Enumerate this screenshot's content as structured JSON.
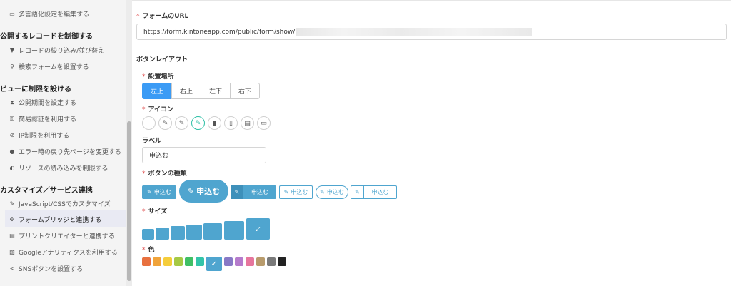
{
  "sidebar": {
    "items": [
      {
        "icon": "▭",
        "label": "多言語化設定を編集する"
      },
      {
        "icon": "▼",
        "label": "レコードの絞り込み/並び替え"
      },
      {
        "icon": "⚲",
        "label": "検索フォームを設置する"
      },
      {
        "icon": "⧗",
        "label": "公開期間を設定する"
      },
      {
        "icon": "⚿",
        "label": "簡易認証を利用する"
      },
      {
        "icon": "⊘",
        "label": "IP制限を利用する"
      },
      {
        "icon": "●",
        "label": "エラー時の戻り先ページを変更する"
      },
      {
        "icon": "◐",
        "label": "リソースの読み込みを制限する"
      },
      {
        "icon": "✎",
        "label": "JavaScript/CSSでカスタマイズ"
      },
      {
        "icon": "✣",
        "label": "フォームブリッジと連携する"
      },
      {
        "icon": "▤",
        "label": "プリントクリエイターと連携する"
      },
      {
        "icon": "▨",
        "label": "Googleアナリティクスを利用する"
      },
      {
        "icon": "≺",
        "label": "SNSボタンを設置する"
      }
    ],
    "headings": [
      "公開するレコードを制御する",
      "ビューに制限を設ける",
      "カスタマイズ／サービス連携"
    ]
  },
  "form": {
    "required_mark": "*",
    "url_label": "フォームのURL",
    "url_value": "https://form.kintoneapp.com/public/form/show/",
    "layout_heading": "ボタンレイアウト",
    "position_label": "設置場所",
    "positions": [
      "左上",
      "右上",
      "左下",
      "右下"
    ],
    "selected_position": "左上",
    "icon_label": "アイコン",
    "icon_names": [
      "blank-icon",
      "pencil-icon",
      "edit-icon",
      "edit-square-icon",
      "file-icon",
      "file-outline-icon",
      "file-text-icon",
      "file-text-outline-icon"
    ],
    "icon_glyphs": [
      "",
      "✎",
      "✎",
      "✎",
      "▮",
      "▯",
      "▤",
      "▭"
    ],
    "label_label": "ラベル",
    "label_value": "申込む",
    "button_type_label": "ボタンの種類",
    "button_type_text": "申込む",
    "size_label": "サイズ",
    "color_label": "色",
    "accent": "#4fa5cf",
    "colors": [
      "#e8713f",
      "#f0a33a",
      "#f5cd3b",
      "#a6c944",
      "#40bf65",
      "#33c4a9",
      "#4fa5cf",
      "#8879c6",
      "#b57bcc",
      "#e6769d",
      "#b89b6c",
      "#7a7a7a",
      "#222222"
    ],
    "selected_color_index": 6,
    "check_glyph": "✓"
  }
}
